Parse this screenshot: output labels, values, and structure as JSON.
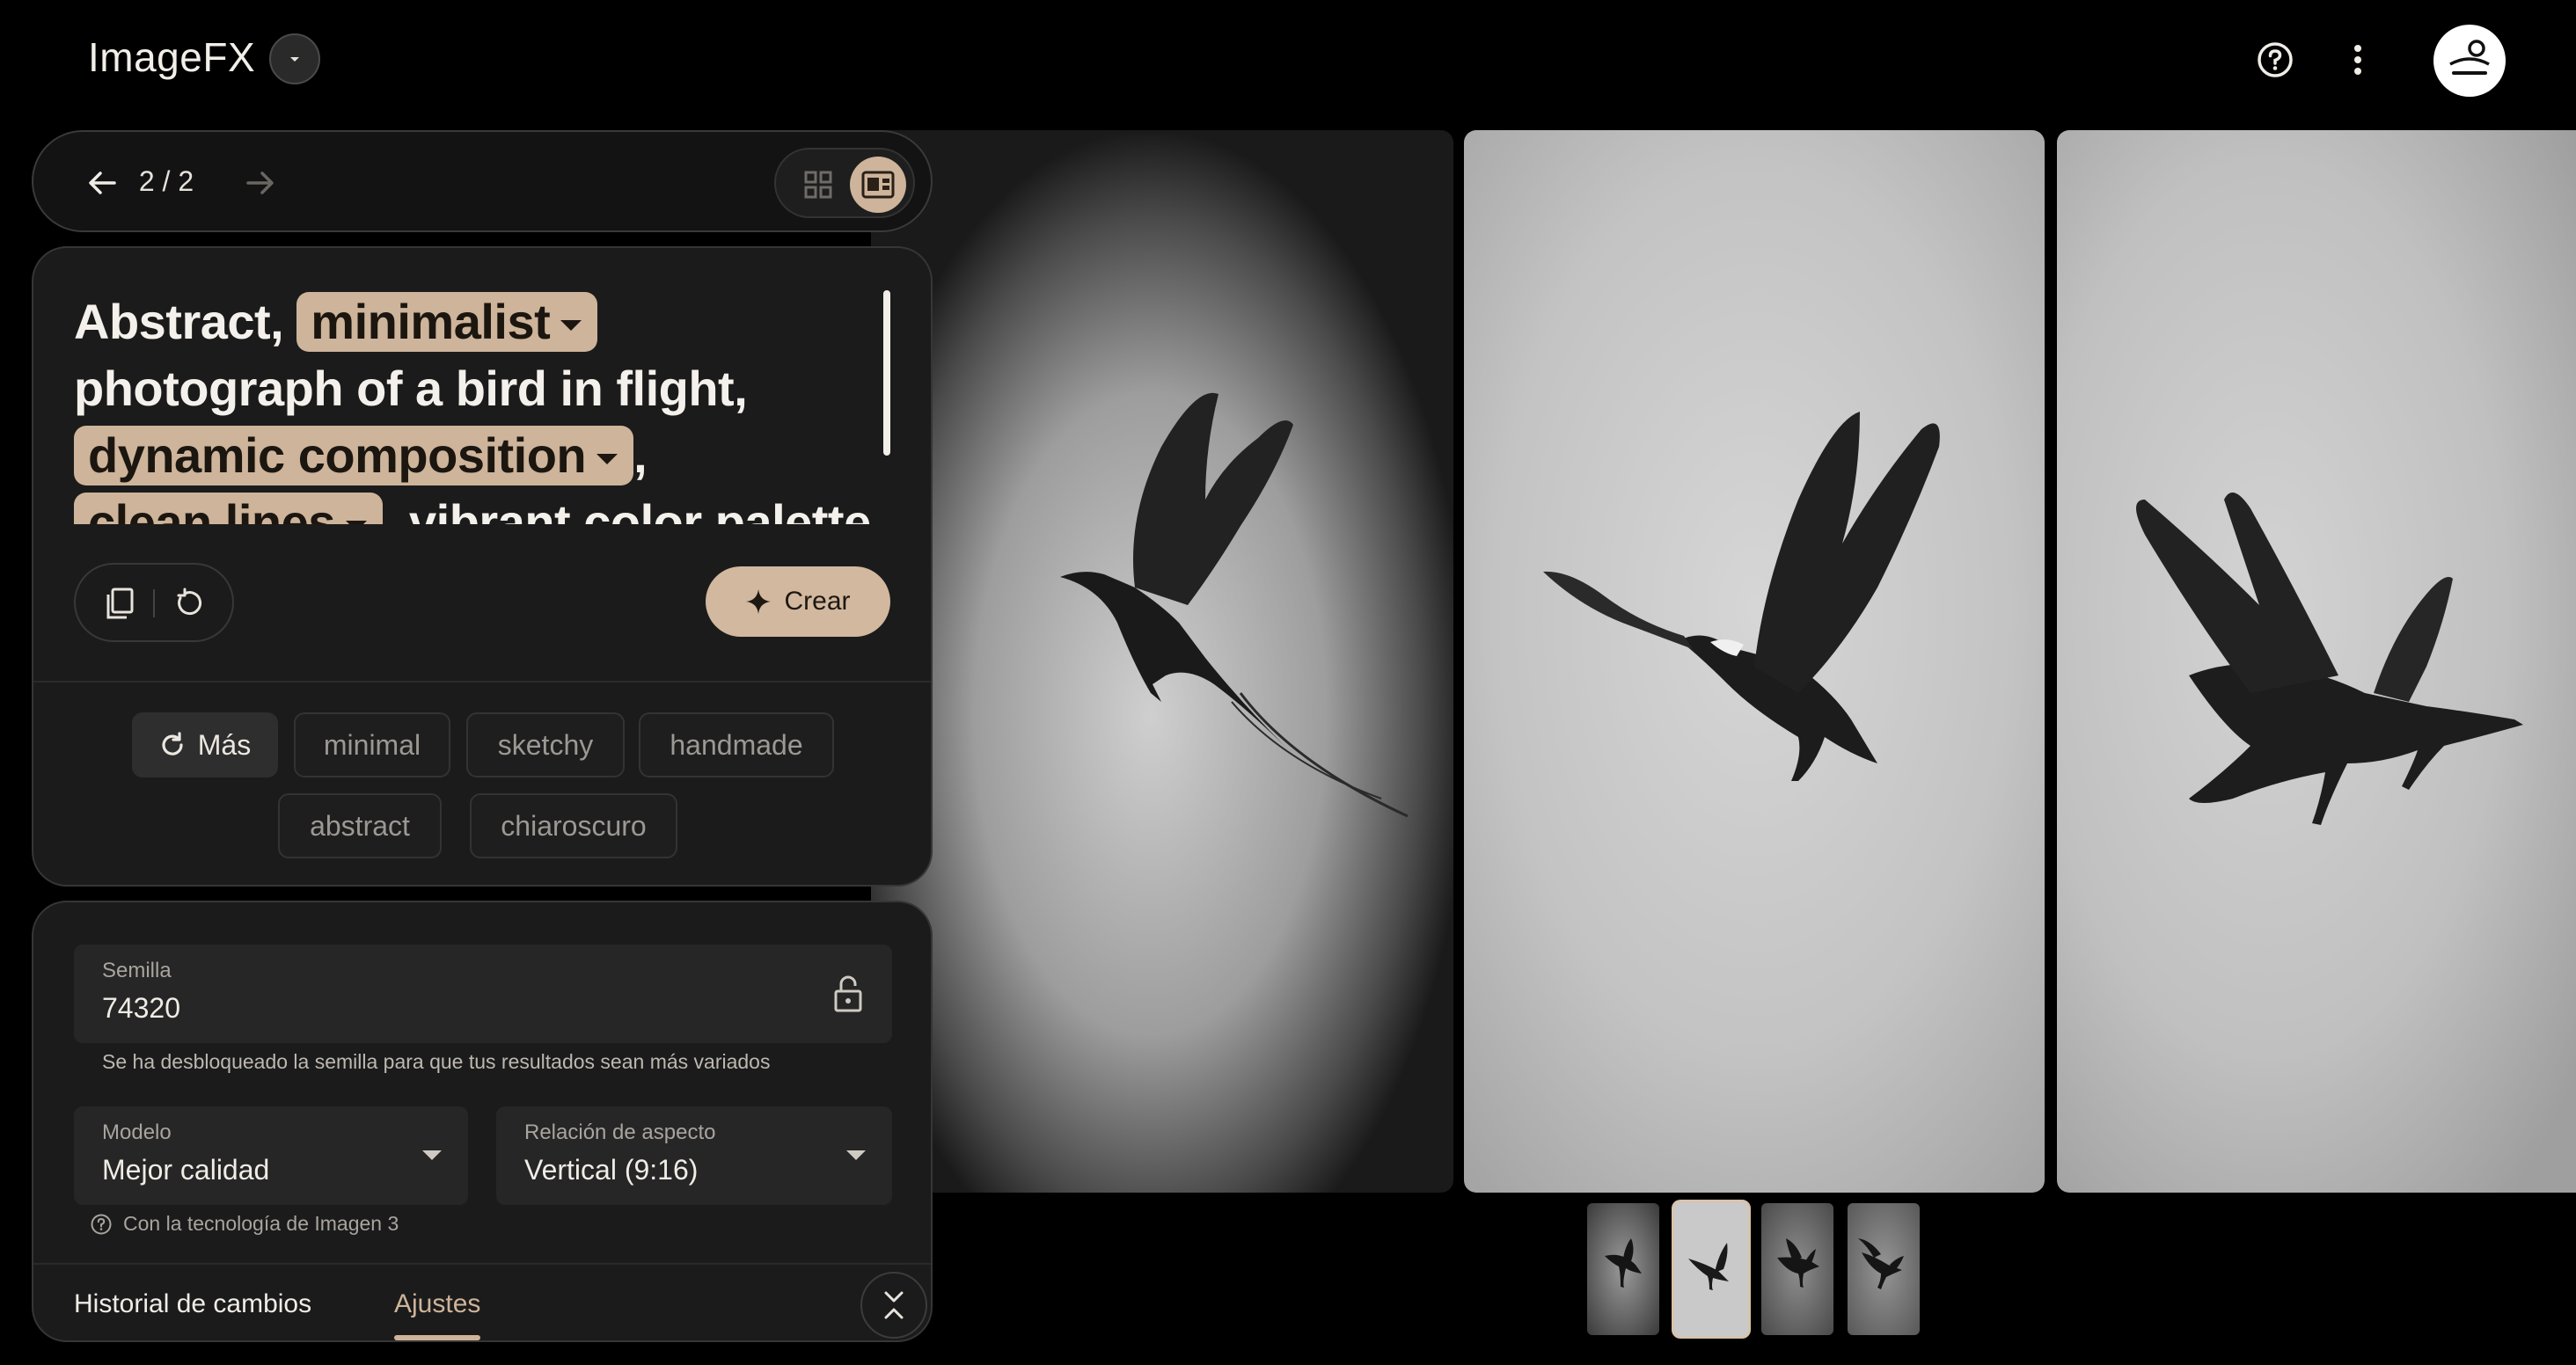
{
  "header": {
    "app_title": "ImageFX",
    "icons": [
      "chevron-down-icon",
      "help-icon",
      "more-vert-icon",
      "avatar"
    ]
  },
  "nav": {
    "counter": "2 / 2"
  },
  "prompt": {
    "segments": [
      {
        "type": "text",
        "value": "Abstract, "
      },
      {
        "type": "chip",
        "value": "minimalist"
      },
      {
        "type": "text",
        "value": " photograph of a bird in flight, "
      },
      {
        "type": "chip",
        "value": "dynamic composition"
      },
      {
        "type": "text",
        "value": ", "
      },
      {
        "type": "chip",
        "value": "clean lines"
      },
      {
        "type": "text",
        "value": " vibrant color palette"
      }
    ],
    "text_1": "Abstract,",
    "chip_1": "minimalist",
    "text_2": "photograph",
    "text_3": "of a bird in flight,",
    "chip_2": "dynamic composition",
    "text_4": ",",
    "chip_3": "clean lines",
    "text_5": "vibrant color palette"
  },
  "actions": {
    "create_label": "Crear"
  },
  "suggestions": {
    "more_label": "Más",
    "items": [
      "minimal",
      "sketchy",
      "handmade",
      "abstract",
      "chiaroscuro"
    ]
  },
  "settings": {
    "seed_label": "Semilla",
    "seed_value": "74320",
    "seed_hint": "Se ha desbloqueado la semilla para que tus resultados sean más variados",
    "model_label": "Modelo",
    "model_value": "Mejor calidad",
    "aspect_label": "Relación de aspecto",
    "aspect_value": "Vertical (9:16)",
    "tech_note": "Con la tecnología de Imagen 3"
  },
  "tabs": {
    "history": "Historial de cambios",
    "settings": "Ajustes",
    "active": "Ajustes"
  },
  "gallery": {
    "selected_index": 2,
    "count": 4
  },
  "colors": {
    "accent": "#cdb49a",
    "background": "#000000",
    "panel": "#1b1b1b"
  }
}
